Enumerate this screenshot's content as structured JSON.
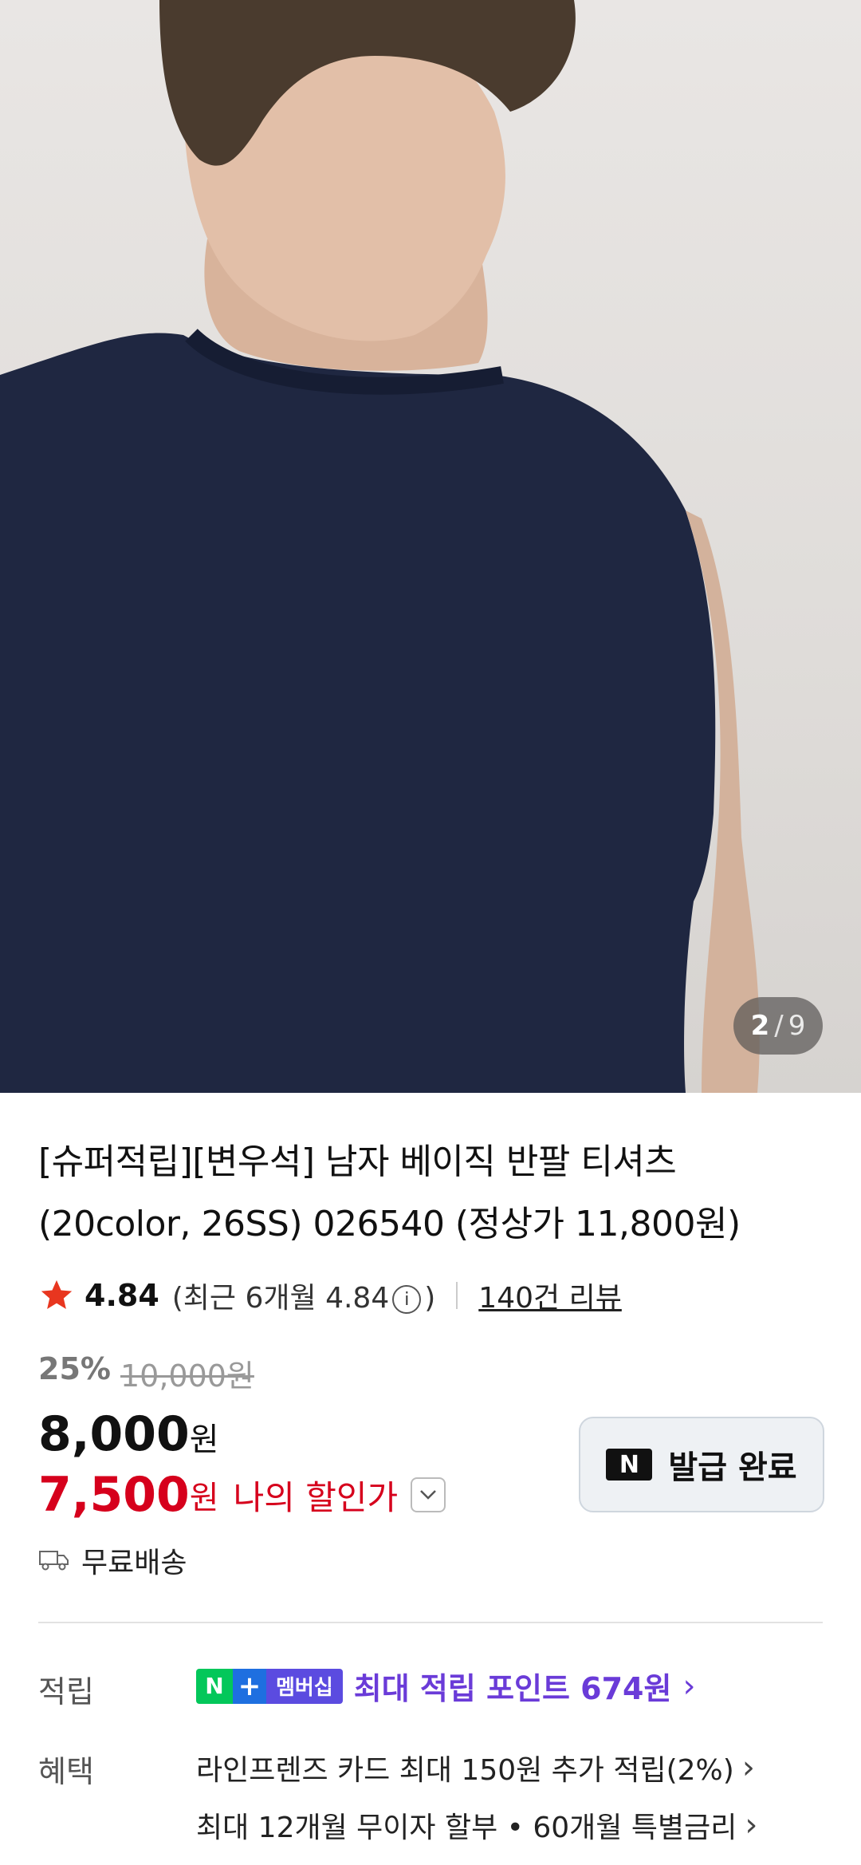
{
  "gallery": {
    "current": "2",
    "separator": "/",
    "total": "9"
  },
  "product": {
    "title": "[슈퍼적립][변우석] 남자 베이직 반팔 티셔츠 (20color, 26SS) 026540 (정상가 11,800원)"
  },
  "rating": {
    "score": "4.84",
    "recent_prefix": "(최근 6개월 4.84",
    "recent_suffix": ")",
    "reviews": "140건 리뷰"
  },
  "price": {
    "discount_rate": "25%",
    "original": "10,000원",
    "sale": "8,000",
    "sale_unit": "원",
    "my_price": "7,500",
    "my_unit": "원",
    "my_label": "나의 할인가"
  },
  "coupon": {
    "label": "발급 완료",
    "logo": "N"
  },
  "shipping": {
    "label": "무료배송"
  },
  "points": {
    "label": "적립",
    "badge_n": "N",
    "badge_plus": "+",
    "badge_member": "멤버십",
    "text": "최대 적립 포인트 674원"
  },
  "benefits": {
    "label": "혜택",
    "items": [
      "라인프렌즈 카드 최대 150원 추가 적립(2%)",
      "최대 12개월 무이자 할부 • 60개월 특별금리"
    ]
  },
  "colors": {
    "accent_red": "#d6001c",
    "points_purple": "#6a3bd8",
    "npay_green": "#03c75a"
  }
}
